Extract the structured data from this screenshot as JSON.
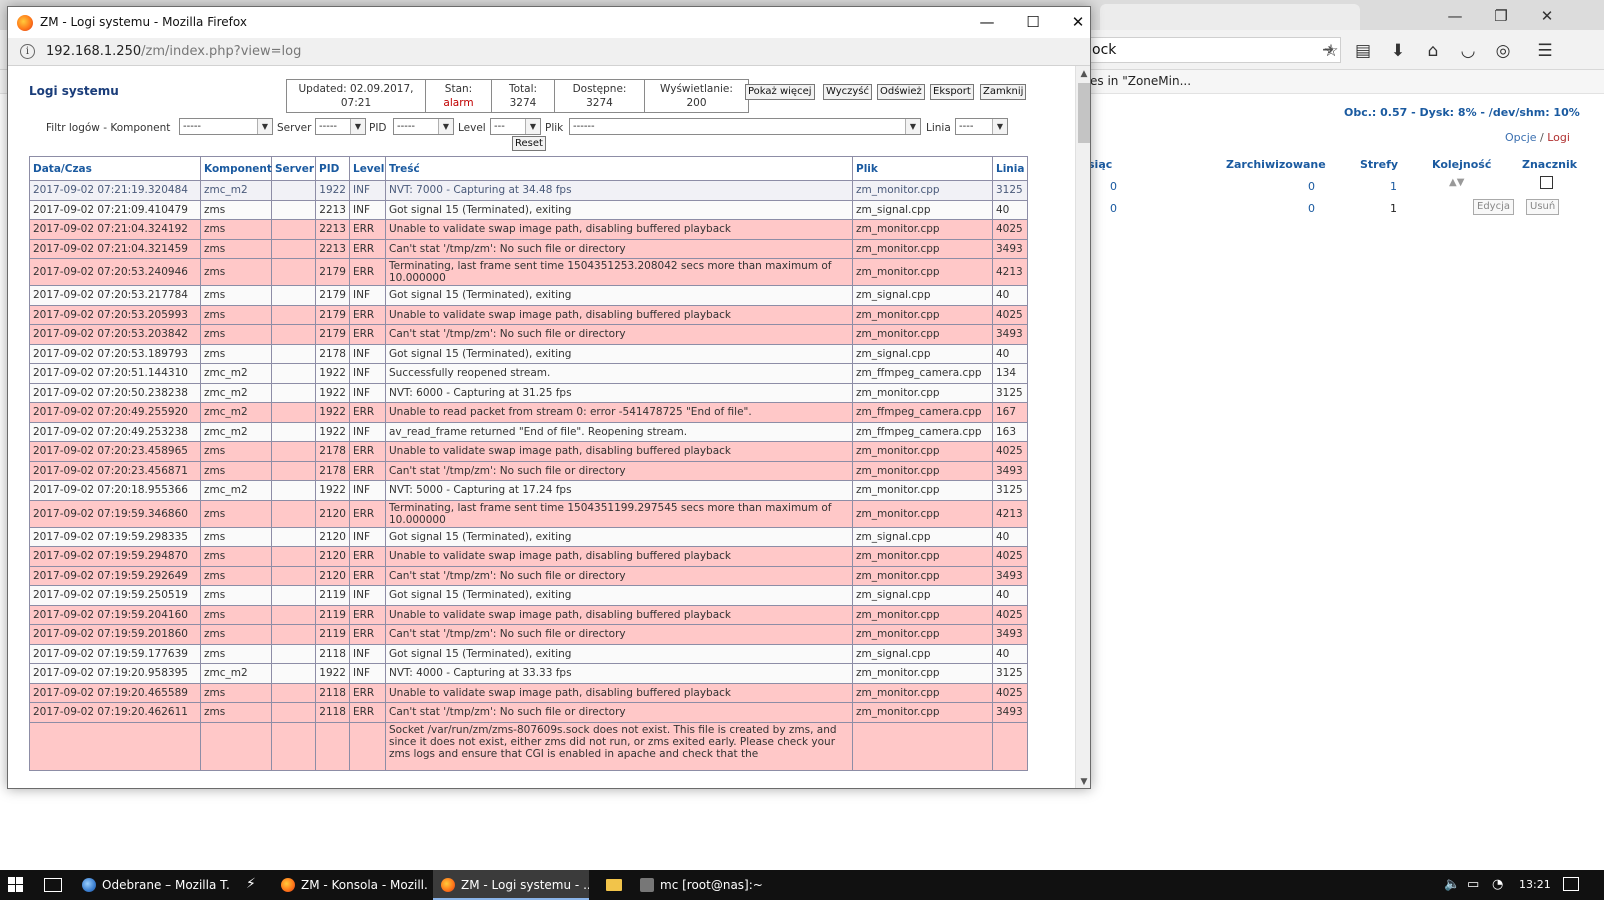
{
  "background_window": {
    "url_partial": "ock",
    "bookmark_partial": "es in \"ZoneMin...",
    "status": "Obc.: 0.57 - Dysk: 8% - /dev/shm: 10%",
    "links": {
      "options": "Opcje",
      "separator": "/",
      "logs": "Logi"
    },
    "table_headers": [
      "siąc",
      "Zarchiwizowane",
      "Strefy",
      "Kolejność",
      "Znacznik"
    ],
    "rows": [
      {
        "c1": "0",
        "c2": "0",
        "c3": "1"
      },
      {
        "c1": "0",
        "c2": "0",
        "c3": "1",
        "edit": "Edycja",
        "delete": "Usuń"
      }
    ]
  },
  "popup": {
    "title": "ZM - Logi systemu - Mozilla Firefox",
    "url_host": "192.168.1.250",
    "url_path": "/zm/index.php?view=log",
    "heading": "Logi systemu",
    "summary": {
      "updated_label": "Updated: 02.09.2017,",
      "updated_time": "07:21",
      "state_label": "Stan:",
      "state_value": "alarm",
      "total_label": "Total:",
      "total_value": "3274",
      "available_label": "Dostępne:",
      "available_value": "3274",
      "display_label": "Wyświetlanie:",
      "display_value": "200"
    },
    "actions": {
      "more": "Pokaż więcej",
      "clear": "Wyczyść",
      "refresh": "Odśwież",
      "export": "Eksport",
      "close": "Zamknij"
    },
    "filters": {
      "component_label": "Filtr logów - Komponent",
      "component_value": "-----",
      "server_label": "Server",
      "server_value": "-----",
      "pid_label": "PID",
      "pid_value": "-----",
      "level_label": "Level",
      "level_value": "---",
      "file_label": "Plik",
      "file_value": "------",
      "line_label": "Linia",
      "line_value": "----",
      "reset": "Reset"
    },
    "table": {
      "headers": [
        "Data/Czas",
        "Komponent",
        "Server",
        "PID",
        "Level",
        "Treść",
        "Plik",
        "Linia"
      ],
      "rows": [
        {
          "d": "2017-09-02 07:21:19.320484",
          "c": "zmc_m2",
          "p": "1922",
          "l": "INF",
          "m": "NVT: 7000 - Capturing at 34.48 fps",
          "f": "zm_monitor.cpp",
          "n": "3125"
        },
        {
          "d": "2017-09-02 07:21:09.410479",
          "c": "zms",
          "p": "2213",
          "l": "INF",
          "m": "Got signal 15 (Terminated), exiting",
          "f": "zm_signal.cpp",
          "n": "40"
        },
        {
          "d": "2017-09-02 07:21:04.324192",
          "c": "zms",
          "p": "2213",
          "l": "ERR",
          "m": "Unable to validate swap image path, disabling buffered playback",
          "f": "zm_monitor.cpp",
          "n": "4025"
        },
        {
          "d": "2017-09-02 07:21:04.321459",
          "c": "zms",
          "p": "2213",
          "l": "ERR",
          "m": "Can't stat '/tmp/zm': No such file or directory",
          "f": "zm_monitor.cpp",
          "n": "3493"
        },
        {
          "d": "2017-09-02 07:20:53.240946",
          "c": "zms",
          "p": "2179",
          "l": "ERR",
          "m": "Terminating, last frame sent time 1504351253.208042 secs more than maximum of 10.000000",
          "f": "zm_monitor.cpp",
          "n": "4213"
        },
        {
          "d": "2017-09-02 07:20:53.217784",
          "c": "zms",
          "p": "2179",
          "l": "INF",
          "m": "Got signal 15 (Terminated), exiting",
          "f": "zm_signal.cpp",
          "n": "40"
        },
        {
          "d": "2017-09-02 07:20:53.205993",
          "c": "zms",
          "p": "2179",
          "l": "ERR",
          "m": "Unable to validate swap image path, disabling buffered playback",
          "f": "zm_monitor.cpp",
          "n": "4025"
        },
        {
          "d": "2017-09-02 07:20:53.203842",
          "c": "zms",
          "p": "2179",
          "l": "ERR",
          "m": "Can't stat '/tmp/zm': No such file or directory",
          "f": "zm_monitor.cpp",
          "n": "3493"
        },
        {
          "d": "2017-09-02 07:20:53.189793",
          "c": "zms",
          "p": "2178",
          "l": "INF",
          "m": "Got signal 15 (Terminated), exiting",
          "f": "zm_signal.cpp",
          "n": "40"
        },
        {
          "d": "2017-09-02 07:20:51.144310",
          "c": "zmc_m2",
          "p": "1922",
          "l": "INF",
          "m": "Successfully reopened stream.",
          "f": "zm_ffmpeg_camera.cpp",
          "n": "134"
        },
        {
          "d": "2017-09-02 07:20:50.238238",
          "c": "zmc_m2",
          "p": "1922",
          "l": "INF",
          "m": "NVT: 6000 - Capturing at 31.25 fps",
          "f": "zm_monitor.cpp",
          "n": "3125"
        },
        {
          "d": "2017-09-02 07:20:49.255920",
          "c": "zmc_m2",
          "p": "1922",
          "l": "ERR",
          "m": "Unable to read packet from stream 0: error -541478725 \"End of file\".",
          "f": "zm_ffmpeg_camera.cpp",
          "n": "167"
        },
        {
          "d": "2017-09-02 07:20:49.253238",
          "c": "zmc_m2",
          "p": "1922",
          "l": "INF",
          "m": "av_read_frame returned \"End of file\". Reopening stream.",
          "f": "zm_ffmpeg_camera.cpp",
          "n": "163"
        },
        {
          "d": "2017-09-02 07:20:23.458965",
          "c": "zms",
          "p": "2178",
          "l": "ERR",
          "m": "Unable to validate swap image path, disabling buffered playback",
          "f": "zm_monitor.cpp",
          "n": "4025"
        },
        {
          "d": "2017-09-02 07:20:23.456871",
          "c": "zms",
          "p": "2178",
          "l": "ERR",
          "m": "Can't stat '/tmp/zm': No such file or directory",
          "f": "zm_monitor.cpp",
          "n": "3493"
        },
        {
          "d": "2017-09-02 07:20:18.955366",
          "c": "zmc_m2",
          "p": "1922",
          "l": "INF",
          "m": "NVT: 5000 - Capturing at 17.24 fps",
          "f": "zm_monitor.cpp",
          "n": "3125"
        },
        {
          "d": "2017-09-02 07:19:59.346860",
          "c": "zms",
          "p": "2120",
          "l": "ERR",
          "m": "Terminating, last frame sent time 1504351199.297545 secs more than maximum of 10.000000",
          "f": "zm_monitor.cpp",
          "n": "4213"
        },
        {
          "d": "2017-09-02 07:19:59.298335",
          "c": "zms",
          "p": "2120",
          "l": "INF",
          "m": "Got signal 15 (Terminated), exiting",
          "f": "zm_signal.cpp",
          "n": "40"
        },
        {
          "d": "2017-09-02 07:19:59.294870",
          "c": "zms",
          "p": "2120",
          "l": "ERR",
          "m": "Unable to validate swap image path, disabling buffered playback",
          "f": "zm_monitor.cpp",
          "n": "4025"
        },
        {
          "d": "2017-09-02 07:19:59.292649",
          "c": "zms",
          "p": "2120",
          "l": "ERR",
          "m": "Can't stat '/tmp/zm': No such file or directory",
          "f": "zm_monitor.cpp",
          "n": "3493"
        },
        {
          "d": "2017-09-02 07:19:59.250519",
          "c": "zms",
          "p": "2119",
          "l": "INF",
          "m": "Got signal 15 (Terminated), exiting",
          "f": "zm_signal.cpp",
          "n": "40"
        },
        {
          "d": "2017-09-02 07:19:59.204160",
          "c": "zms",
          "p": "2119",
          "l": "ERR",
          "m": "Unable to validate swap image path, disabling buffered playback",
          "f": "zm_monitor.cpp",
          "n": "4025"
        },
        {
          "d": "2017-09-02 07:19:59.201860",
          "c": "zms",
          "p": "2119",
          "l": "ERR",
          "m": "Can't stat '/tmp/zm': No such file or directory",
          "f": "zm_monitor.cpp",
          "n": "3493"
        },
        {
          "d": "2017-09-02 07:19:59.177639",
          "c": "zms",
          "p": "2118",
          "l": "INF",
          "m": "Got signal 15 (Terminated), exiting",
          "f": "zm_signal.cpp",
          "n": "40"
        },
        {
          "d": "2017-09-02 07:19:20.958395",
          "c": "zmc_m2",
          "p": "1922",
          "l": "INF",
          "m": "NVT: 4000 - Capturing at 33.33 fps",
          "f": "zm_monitor.cpp",
          "n": "3125"
        },
        {
          "d": "2017-09-02 07:19:20.465589",
          "c": "zms",
          "p": "2118",
          "l": "ERR",
          "m": "Unable to validate swap image path, disabling buffered playback",
          "f": "zm_monitor.cpp",
          "n": "4025"
        },
        {
          "d": "2017-09-02 07:19:20.462611",
          "c": "zms",
          "p": "2118",
          "l": "ERR",
          "m": "Can't stat '/tmp/zm': No such file or directory",
          "f": "zm_monitor.cpp",
          "n": "3493"
        },
        {
          "d": "",
          "c": "",
          "p": "",
          "l": "",
          "m": "Socket /var/run/zm/zms-807609s.sock does not exist. This file is created by zms, and since it does not exist, either zms did not run, or zms exited early. Please check your zms logs and ensure that CGI is enabled in apache and check that the",
          "f": "",
          "n": "",
          "cls": "ERR"
        }
      ]
    }
  },
  "taskbar": {
    "apps": [
      {
        "label": "Odebrane – Mozilla T...",
        "icon": "thunderbird-icon"
      },
      {
        "label": "ZM - Konsola - Mozill...",
        "icon": "firefox-icon"
      },
      {
        "label": "ZM - Logi systemu - ...",
        "icon": "firefox-icon"
      },
      {
        "label": "mc [root@nas]:~",
        "icon": "putty-icon"
      }
    ],
    "clock": "13:21"
  },
  "colors": {
    "error_row": "#ffc8c8",
    "header_text": "#1a5aa0",
    "alarm": "#c00000",
    "taskbar": "#111111"
  }
}
